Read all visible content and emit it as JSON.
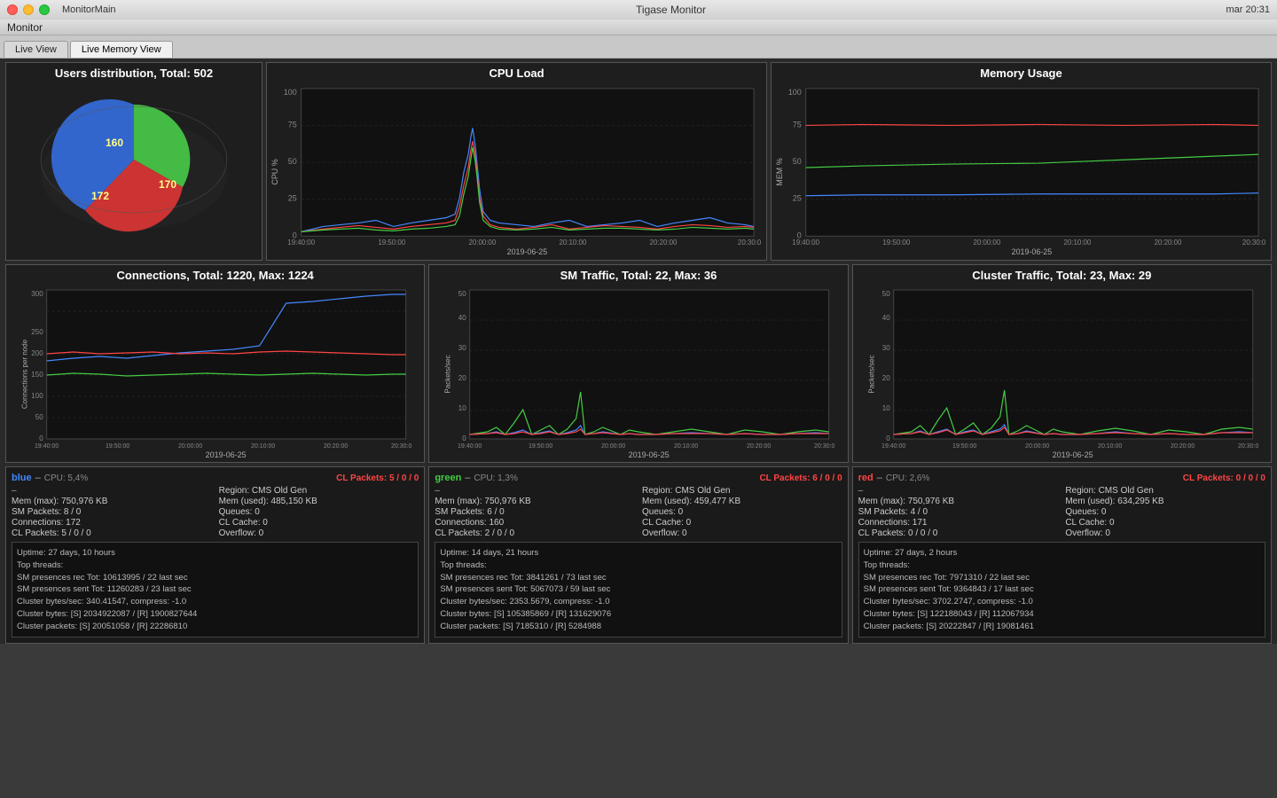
{
  "titlebar": {
    "title": "Tigase Monitor",
    "menu_app": "MonitorMain"
  },
  "menu": {
    "items": [
      "Monitor"
    ]
  },
  "tabs": [
    {
      "label": "Live View",
      "active": false
    },
    {
      "label": "Live Memory View",
      "active": true
    }
  ],
  "users_dist": {
    "title": "Users distribution, Total: 502",
    "segments": [
      {
        "label": "160",
        "color": "#44bb44",
        "percent": 31.9
      },
      {
        "label": "170",
        "color": "#cc3333",
        "percent": 33.8
      },
      {
        "label": "172",
        "color": "#3366cc",
        "percent": 34.3
      }
    ]
  },
  "cpu_load": {
    "title": "CPU Load",
    "y_label": "CPU %",
    "x_label": "2019-06-25",
    "x_ticks": [
      "19:40:00",
      "19:50:00",
      "20:00:00",
      "20:10:00",
      "20:20:00",
      "20:30:0"
    ],
    "y_ticks": [
      "0",
      "25",
      "50",
      "75",
      "100"
    ]
  },
  "memory_usage": {
    "title": "Memory Usage",
    "y_label": "MEM %",
    "x_label": "2019-06-25",
    "x_ticks": [
      "19:40:00",
      "19:50:00",
      "20:00:00",
      "20:10:00",
      "20:20:00",
      "20:30:0"
    ],
    "y_ticks": [
      "0",
      "25",
      "50",
      "75",
      "100"
    ]
  },
  "connections": {
    "title": "Connections, Total: 1220, Max: 1224",
    "y_label": "Connections per node",
    "x_label": "2019-06-25",
    "x_ticks": [
      "19:40:00",
      "19:50:00",
      "20:00:00",
      "20:10:00",
      "20:20:00",
      "20:30:0"
    ],
    "y_ticks": [
      "0",
      "50",
      "100",
      "150",
      "200",
      "250",
      "300"
    ]
  },
  "sm_traffic": {
    "title": "SM Traffic, Total: 22, Max: 36",
    "y_label": "Packets/sec",
    "x_label": "2019-06-25",
    "x_ticks": [
      "19:40:00",
      "19:50:00",
      "20:00:00",
      "20:10:00",
      "20:20:00",
      "20:30:0"
    ],
    "y_ticks": [
      "0",
      "10",
      "20",
      "30",
      "40",
      "50"
    ]
  },
  "cluster_traffic": {
    "title": "Cluster Traffic, Total: 23, Max: 29",
    "y_label": "Packets/sec",
    "x_label": "2019-06-25",
    "x_ticks": [
      "19:40:00",
      "19:50:00",
      "20:00:00",
      "20:10:00",
      "20:20:00",
      "20:30:0"
    ],
    "y_ticks": [
      "0",
      "10",
      "20",
      "30",
      "40",
      "50"
    ]
  },
  "nodes": [
    {
      "name": "blue",
      "color": "#4488ff",
      "cpu": "CPU: 5,4%",
      "cl_packets_label": "CL Packets: 5 / 0 / 0",
      "dash1": "–",
      "region": "Region: CMS Old Gen",
      "mem_max": "Mem (max): 750,976 KB",
      "mem_used": "Mem (used): 485,150 KB",
      "sm_packets": "SM Packets: 8 / 0",
      "queues": "Queues: 0",
      "connections": "Connections: 172",
      "cl_cache": "CL Cache: 0",
      "cl_packets2": "CL Packets: 5 / 0 / 0",
      "overflow": "Overflow: 0",
      "uptime": "Uptime: 27 days, 10 hours",
      "top_threads": "Top threads:",
      "line1": "SM presences rec Tot: 10613995 / 22 last sec",
      "line2": "SM presences sent Tot: 11260283 / 23 last sec",
      "line3": "Cluster bytes/sec: 340.41547, compress: -1.0",
      "line4": "Cluster bytes: [S] 2034922087 / [R] 1900827644",
      "line5": "Cluster packets: [S] 20051058 / [R] 22286810"
    },
    {
      "name": "green",
      "color": "#44cc44",
      "cpu": "CPU: 1,3%",
      "cl_packets_label": "CL Packets: 6 / 0 / 0",
      "dash1": "–",
      "region": "Region: CMS Old Gen",
      "mem_max": "Mem (max): 750,976 KB",
      "mem_used": "Mem (used): 459,477 KB",
      "sm_packets": "SM Packets: 6 / 0",
      "queues": "Queues: 0",
      "connections": "Connections: 160",
      "cl_cache": "CL Cache: 0",
      "cl_packets2": "CL Packets: 2 / 0 / 0",
      "overflow": "Overflow: 0",
      "uptime": "Uptime: 14 days, 21 hours",
      "top_threads": "Top threads:",
      "line1": "SM presences rec Tot: 3841261 / 73 last sec",
      "line2": "SM presences sent Tot: 5067073 / 59 last sec",
      "line3": "Cluster bytes/sec: 2353.5679, compress: -1.0",
      "line4": "Cluster bytes: [S] 105385869 / [R] 131629076",
      "line5": "Cluster packets: [S] 7185310 / [R] 5284988"
    },
    {
      "name": "red",
      "color": "#ff4444",
      "cpu": "CPU: 2,6%",
      "cl_packets_label": "CL Packets: 0 / 0 / 0",
      "dash1": "–",
      "region": "Region: CMS Old Gen",
      "mem_max": "Mem (max): 750,976 KB",
      "mem_used": "Mem (used): 634,295 KB",
      "sm_packets": "SM Packets: 4 / 0",
      "queues": "Queues: 0",
      "connections": "Connections: 171",
      "cl_cache": "CL Cache: 0",
      "cl_packets2": "CL Packets: 0 / 0 / 0",
      "overflow": "Overflow: 0",
      "uptime": "Uptime: 27 days, 2 hours",
      "top_threads": "Top threads:",
      "line1": "SM presences rec Tot: 7971310 / 22 last sec",
      "line2": "SM presences sent Tot: 9364843 / 17 last sec",
      "line3": "Cluster bytes/sec: 3702.2747, compress: -1.0",
      "line4": "Cluster bytes: [S] 122188043 / [R] 112067934",
      "line5": "Cluster packets: [S] 20222847 / [R] 19081461"
    }
  ]
}
